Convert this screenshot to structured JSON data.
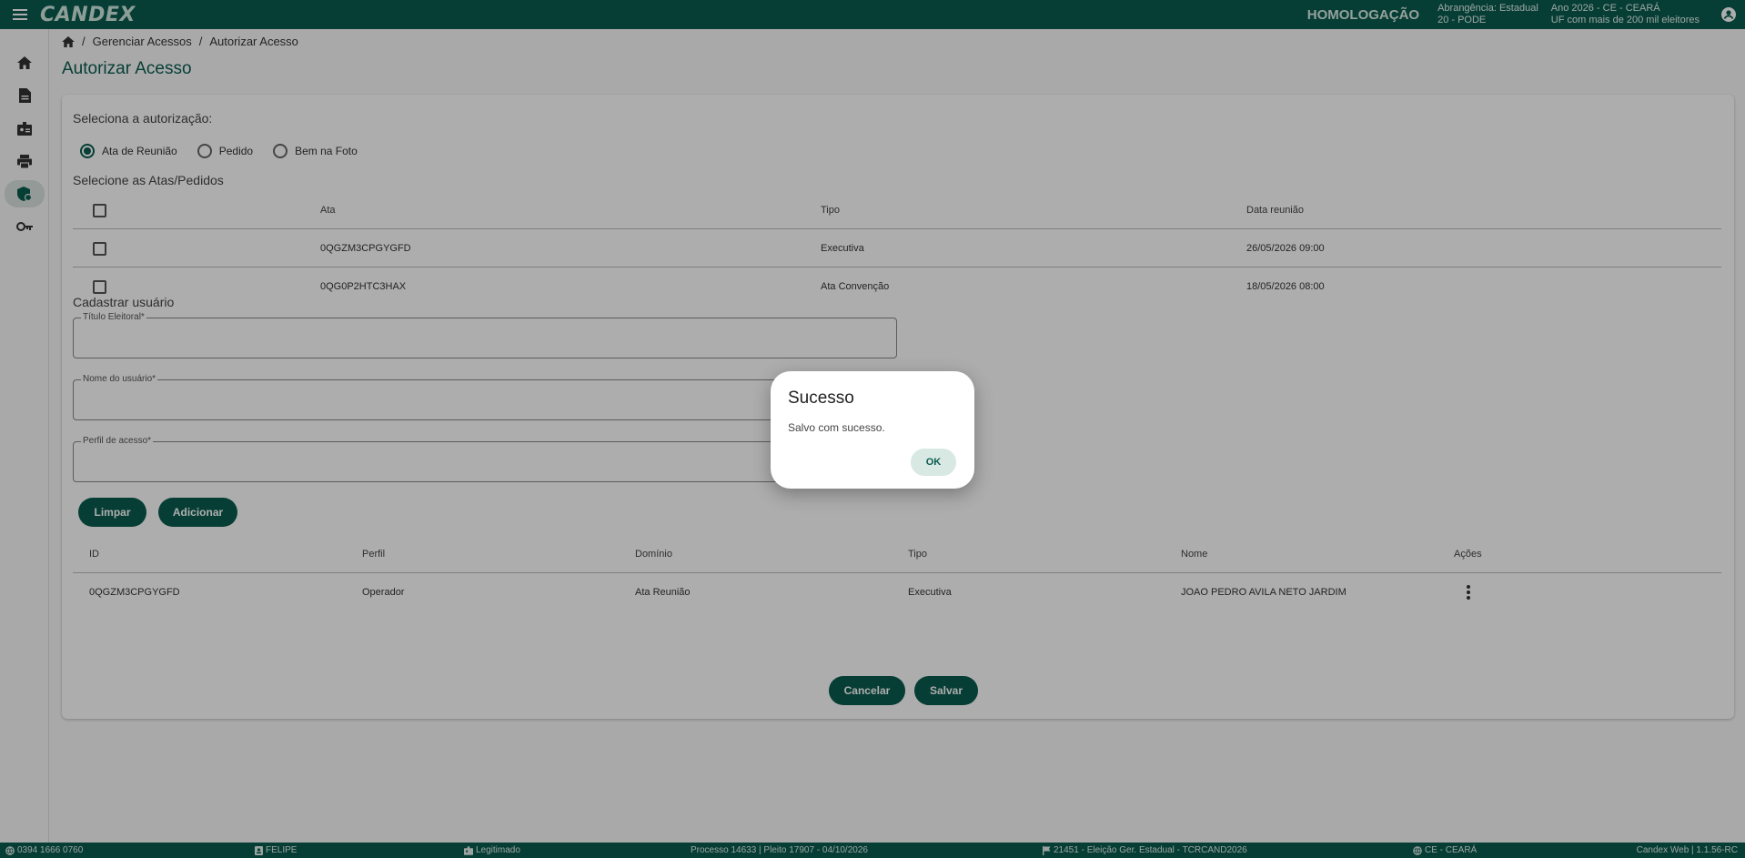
{
  "app": {
    "logo": "CANDEX",
    "environment": "HOMOLOGAÇÃO",
    "scope_line1": "Abrangência: Estadual",
    "scope_line2": "20 - PODE",
    "year_line1": "Ano 2026 - CE - CEARÁ",
    "year_line2": "UF com mais de 200 mil eleitores"
  },
  "sidebar": {
    "items": [
      {
        "icon": "home-icon"
      },
      {
        "icon": "document-icon"
      },
      {
        "icon": "badge-icon"
      },
      {
        "icon": "printer-icon"
      },
      {
        "icon": "shield-settings-icon",
        "active": true
      },
      {
        "icon": "key-icon"
      }
    ]
  },
  "breadcrumb": {
    "sep1": "/",
    "item1": "Gerenciar Acessos",
    "sep2": "/",
    "item2": "Autorizar Acesso"
  },
  "page": {
    "title": "Autorizar Acesso",
    "select_label": "Seleciona a autorização:",
    "radios": [
      {
        "label": "Ata de Reunião",
        "checked": true
      },
      {
        "label": "Pedido",
        "checked": false
      },
      {
        "label": "Bem na Foto",
        "checked": false
      }
    ],
    "atas_label": "Selecione as Atas/Pedidos",
    "atas_table": {
      "headers": {
        "ata": "Ata",
        "tipo": "Tipo",
        "data": "Data reunião"
      },
      "rows": [
        {
          "ata": "0QGZM3CPGYGFD",
          "tipo": "Executiva",
          "data": "26/05/2026 09:00"
        },
        {
          "ata": "0QG0P2HTC3HAX",
          "tipo": "Ata Convenção",
          "data": "18/05/2026 08:00"
        }
      ]
    },
    "cadastrar_label": "Cadastrar usuário",
    "fields": {
      "titulo": "Título Eleitoral*",
      "nome": "Nome do usuário*",
      "perfil": "Perfil de acesso*"
    },
    "buttons": {
      "limpar": "Limpar",
      "adicionar": "Adicionar",
      "cancelar": "Cancelar",
      "salvar": "Salvar"
    },
    "users_table": {
      "headers": {
        "id": "ID",
        "perfil": "Perfil",
        "dominio": "Domínio",
        "tipo": "Tipo",
        "nome": "Nome",
        "acoes": "Ações"
      },
      "rows": [
        {
          "id": "0QGZM3CPGYGFD",
          "perfil": "Operador",
          "dominio": "Ata Reunião",
          "tipo": "Executiva",
          "nome": "JOAO PEDRO AVILA NETO JARDIM"
        }
      ]
    }
  },
  "dialog": {
    "title": "Sucesso",
    "message": "Salvo com sucesso.",
    "ok": "OK"
  },
  "footer": {
    "ip": "0394 1666 0760",
    "user": "FELIPE",
    "status": "Legitimado",
    "processo": "Processo 14633 | Pleito 17907 - 04/10/2026",
    "eleicao": "21451 - Eleição Ger. Estadual - TCRCAND2026",
    "uf": "CE - CEARÁ",
    "version": "Candex Web | 1.1.56-RC"
  },
  "colors": {
    "primary": "#0a5c4e",
    "accent_light": "#d8e8e3"
  }
}
